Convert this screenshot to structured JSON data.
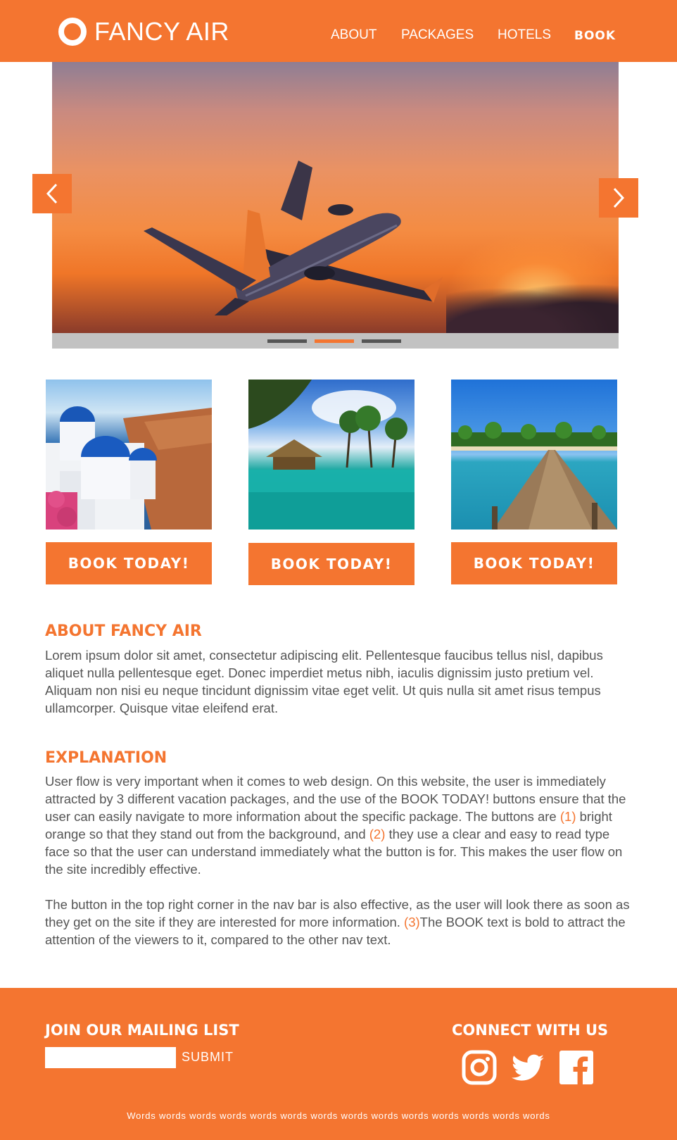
{
  "nav": {
    "brand": "FANCY AIR",
    "links": [
      "ABOUT",
      "PACKAGES",
      "HOTELS",
      "BOOK"
    ]
  },
  "hero": {
    "slide_count": 3,
    "active_slide": 2
  },
  "packages": [
    {
      "button": "BOOK TODAY!"
    },
    {
      "button": "BOOK TODAY!"
    },
    {
      "button": "BOOK TODAY!"
    }
  ],
  "about": {
    "title": "ABOUT FANCY AIR",
    "body": "Lorem ipsum dolor sit amet, consectetur adipiscing elit. Pellentesque faucibus tellus nisl, dapibus aliquet nulla pellentesque eget. Donec imperdiet metus nibh, iaculis dignissim justo pretium vel. Aliquam non nisi eu neque tincidunt dignissim vitae eget velit. Ut quis nulla sit amet risus tempus ullamcorper. Quisque vitae eleifend erat."
  },
  "explanation": {
    "title": "EXPLANATION",
    "p1_a": "User flow is very important when it comes to web design. On this website, the user is immediately attracted by 3 different vacation packages, and the use of the BOOK TODAY! buttons ensure that the user can easily navigate to more information about the specific package. The buttons are ",
    "mark1": "(1)",
    "p1_b": " bright orange so that they stand out from the background, and ",
    "mark2": "(2)",
    "p1_c": " they use a clear and easy to read type face so that the user can understand immediately what the button is for. This makes the user flow on the site incredibly effective.",
    "p2_a": "The button in the top right corner in the nav bar is also effective, as the user will look there as soon as they get on the site if they are interested for more information. ",
    "mark3": "(3)",
    "p2_b": "The BOOK text is bold to attract the attention of the viewers to it, compared to the other nav text."
  },
  "footer": {
    "mailing_title": "JOIN OUR MAILING LIST",
    "email_value": "",
    "submit_label": "SUBMIT",
    "connect_title": "CONNECT WITH US",
    "socials": [
      "instagram-icon",
      "twitter-icon",
      "facebook-icon"
    ],
    "tagline": "Words words words words words words words words words words words words words words"
  },
  "colors": {
    "accent": "#f47530",
    "text": "#555555",
    "slider_track": "#c2c2c2"
  }
}
